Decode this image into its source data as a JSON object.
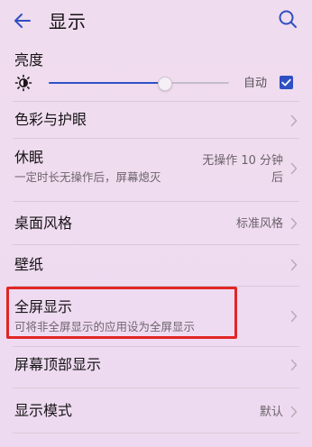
{
  "header": {
    "title": "显示"
  },
  "brightness": {
    "title": "亮度",
    "auto_label": "自动",
    "auto_checked": true,
    "level": 0.64
  },
  "settings": {
    "color_eye": {
      "title": "色彩与护眼"
    },
    "sleep": {
      "title": "休眠",
      "subtitle": "一定时长无操作后，屏幕熄灭",
      "value_line1": "无操作 10 分钟",
      "value_line2": "后"
    },
    "desktop_style": {
      "title": "桌面风格",
      "value": "标准风格"
    },
    "wallpaper": {
      "title": "壁纸"
    },
    "fullscreen": {
      "title": "全屏显示",
      "subtitle": "可将非全屏显示的应用设为全屏显示"
    },
    "top_display": {
      "title": "屏幕顶部显示"
    },
    "display_mode": {
      "title": "显示模式",
      "value": "默认"
    }
  },
  "colors": {
    "accent": "#2f4fc2",
    "highlight_border": "#e02626",
    "background": "#efdcee"
  },
  "icons": {
    "back": "arrow-left",
    "search": "magnifier",
    "brightness": "sun",
    "chevron": "chevron-right",
    "check": "checkmark"
  }
}
